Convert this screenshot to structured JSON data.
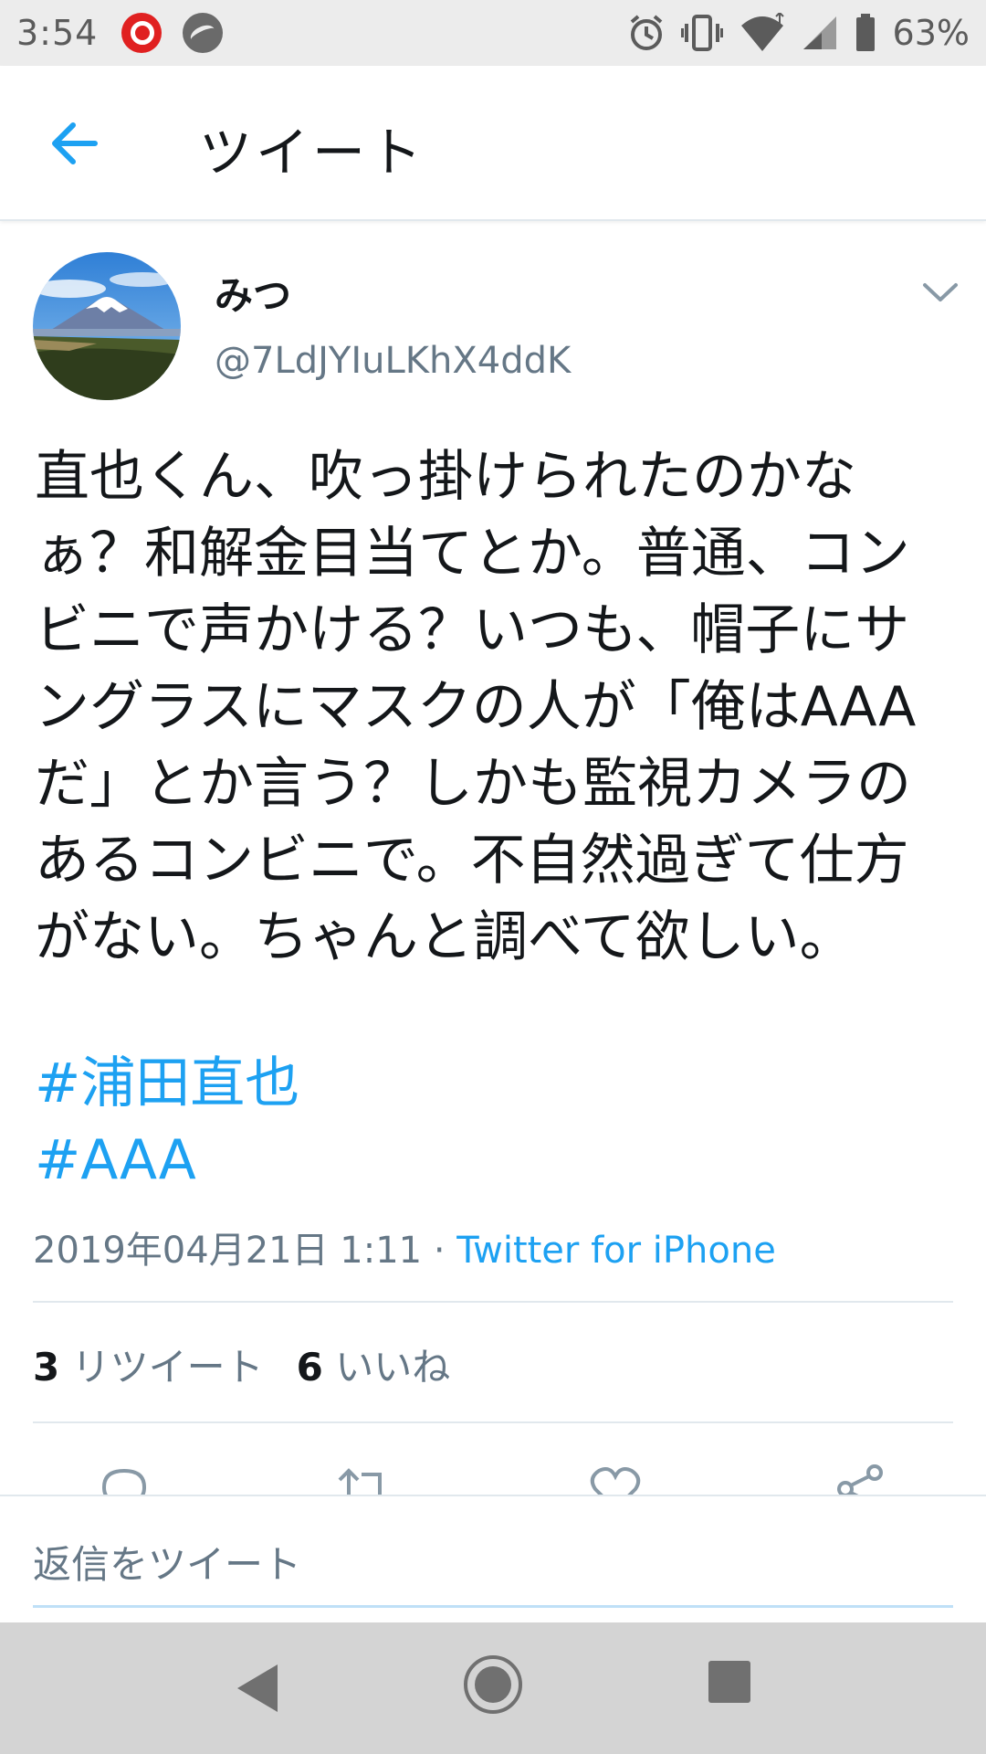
{
  "status_bar": {
    "time": "3:54",
    "battery_percent": "63%",
    "icons": [
      "notification-app-icon",
      "notification-app-icon-2",
      "alarm-icon",
      "vibrate-icon",
      "wifi-icon",
      "signal-icon",
      "battery-icon"
    ]
  },
  "app_bar": {
    "title": "ツイート",
    "back_icon": "arrow-left-icon"
  },
  "tweet": {
    "display_name": "みつ",
    "handle": "@7LdJYIuLKhX4ddK",
    "text": "直也くん、吹っ掛けられたのかなぁ？和解金目当てとか。普通、コンビニで声かける？いつも、帽子にサングラスにマスクの人が「俺はAAAだ」とか言う？しかも監視カメラのあるコンビニで。不自然過ぎて仕方がない。ちゃんと調べて欲しい。",
    "hashtags": [
      "#浦田直也",
      "#AAA"
    ],
    "timestamp": "2019年04月21日 1:11",
    "separator": " · ",
    "source": "Twitter for iPhone"
  },
  "stats": {
    "retweets_count": "3",
    "retweets_label": "リツイート",
    "likes_count": "6",
    "likes_label": "いいね"
  },
  "actions": [
    "reply-icon",
    "retweet-icon",
    "like-icon",
    "share-icon"
  ],
  "reply": {
    "placeholder": "返信をツイート"
  },
  "nav": [
    "back-triangle-icon",
    "home-circle-icon",
    "recents-square-icon"
  ],
  "colors": {
    "accent": "#1da1f2",
    "text": "#14171a",
    "secondary": "#657786",
    "divider": "#e1e8ed"
  }
}
